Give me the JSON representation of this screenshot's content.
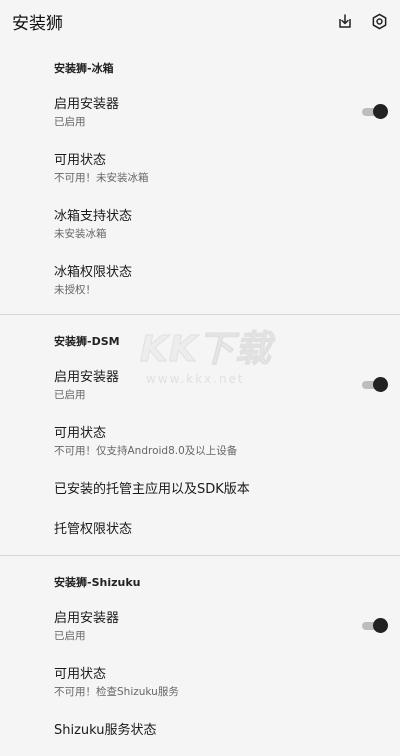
{
  "app": {
    "title": "安装狮"
  },
  "icons": {
    "install": "install-icon",
    "settings": "settings-icon"
  },
  "colors": {
    "accent": "#222222",
    "track": "#bdbdbd",
    "background": "#f5f5f5"
  },
  "sections": [
    {
      "header": "安装狮-冰箱",
      "items": [
        {
          "title": "启用安装器",
          "subtitle": "已启用",
          "switch_on": true
        },
        {
          "title": "可用状态",
          "subtitle": "不可用！未安装冰箱"
        },
        {
          "title": "冰箱支持状态",
          "subtitle": "未安装冰箱"
        },
        {
          "title": "冰箱权限状态",
          "subtitle": "未授权！"
        }
      ]
    },
    {
      "header": "安装狮-DSM",
      "items": [
        {
          "title": "启用安装器",
          "subtitle": "已启用",
          "switch_on": true
        },
        {
          "title": "可用状态",
          "subtitle": "不可用！仅支持Android8.0及以上设备"
        },
        {
          "title": "已安装的托管主应用以及SDK版本"
        },
        {
          "title": "托管权限状态"
        }
      ]
    },
    {
      "header": "安装狮-Shizuku",
      "items": [
        {
          "title": "启用安装器",
          "subtitle": "已启用",
          "switch_on": true
        },
        {
          "title": "可用状态",
          "subtitle": "不可用！检查Shizuku服务"
        },
        {
          "title": "Shizuku服务状态"
        }
      ]
    }
  ],
  "watermark": {
    "logo": "KK下载",
    "url": "www.kkx.net"
  }
}
